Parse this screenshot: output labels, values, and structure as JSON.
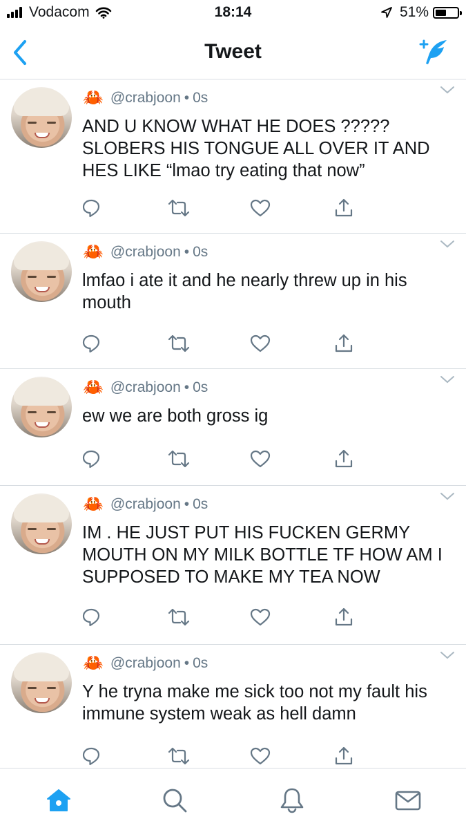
{
  "status_bar": {
    "carrier": "Vodacom",
    "time": "18:14",
    "battery": "51%",
    "battery_level": 0.51
  },
  "nav": {
    "title": "Tweet"
  },
  "colors": {
    "accent": "#1da1f2",
    "text": "#14171a",
    "secondary": "#657786",
    "divider": "#d8dde2",
    "icon_gray": "#657786"
  },
  "tweets": [
    {
      "emoji": "🦀",
      "handle": "@crabjoon",
      "separator": "•",
      "time": "0s",
      "text": "AND U KNOW WHAT HE DOES ????? SLOBERS HIS TONGUE ALL OVER IT AND HES LIKE “lmao try eating that now”"
    },
    {
      "emoji": "🦀",
      "handle": "@crabjoon",
      "separator": "•",
      "time": "0s",
      "text": "lmfao i ate it and he nearly threw up in his mouth"
    },
    {
      "emoji": "🦀",
      "handle": "@crabjoon",
      "separator": "•",
      "time": "0s",
      "text": "ew we are both gross ig"
    },
    {
      "emoji": "🦀",
      "handle": "@crabjoon",
      "separator": "•",
      "time": "0s",
      "text": "IM . HE JUST PUT HIS FUCKEN GERMY MOUTH ON MY MILK BOTTLE TF HOW AM I SUPPOSED TO MAKE MY TEA NOW"
    },
    {
      "emoji": "🦀",
      "handle": "@crabjoon",
      "separator": "•",
      "time": "0s",
      "text": "Y he tryna make me sick too not my fault his immune system weak as hell damn"
    }
  ],
  "tab_bar": {
    "icons": [
      "home-icon",
      "search-icon",
      "bell-icon",
      "mail-icon"
    ],
    "active": "home-icon"
  }
}
